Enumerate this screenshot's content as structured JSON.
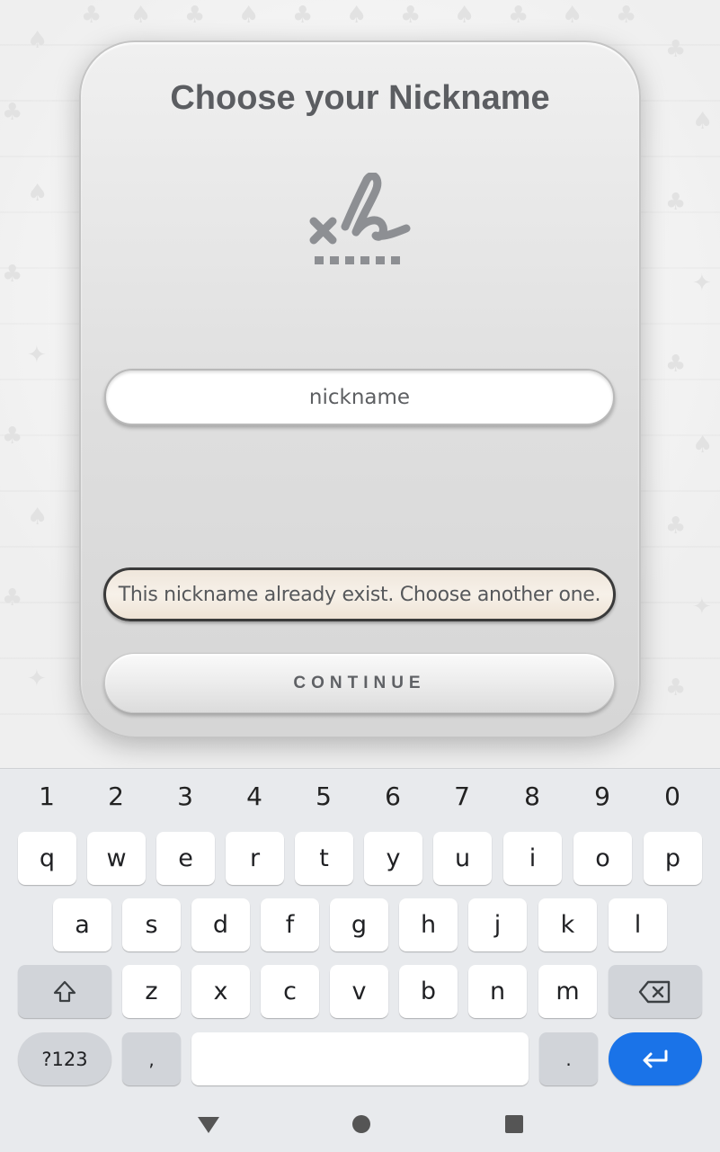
{
  "dialog": {
    "title": "Choose your Nickname",
    "icon": "signature-icon",
    "input": {
      "value": "",
      "placeholder": "nickname"
    },
    "error": "This nickname already exist. Choose another one.",
    "continue_label": "CONTINUE"
  },
  "keyboard": {
    "numbers": [
      "1",
      "2",
      "3",
      "4",
      "5",
      "6",
      "7",
      "8",
      "9",
      "0"
    ],
    "row1": [
      "q",
      "w",
      "e",
      "r",
      "t",
      "y",
      "u",
      "i",
      "o",
      "p"
    ],
    "row2": [
      "a",
      "s",
      "d",
      "f",
      "g",
      "h",
      "j",
      "k",
      "l"
    ],
    "row3": [
      "z",
      "x",
      "c",
      "v",
      "b",
      "n",
      "m"
    ],
    "symbols_label": "?123",
    "comma": ",",
    "period": ".",
    "icons": {
      "shift": "shift-icon",
      "backspace": "backspace-icon",
      "enter": "enter-icon"
    }
  },
  "navbar": {
    "icons": [
      "back-triangle-icon",
      "home-circle-icon",
      "recents-square-icon"
    ]
  },
  "colors": {
    "accent": "#1a73e8",
    "error_border": "#3a3a3a",
    "error_fill": "#f3ece2",
    "title": "#5b5d61"
  }
}
